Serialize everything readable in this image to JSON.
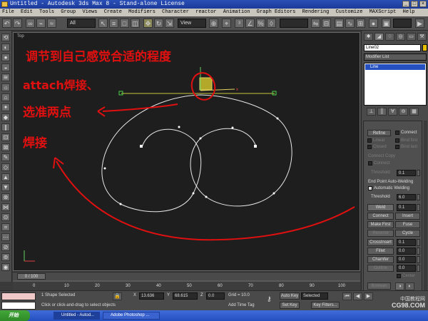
{
  "window": {
    "title": "Untitled - Autodesk 3ds Max 8  - Stand-alone License"
  },
  "menu": [
    "File",
    "Edit",
    "Tools",
    "Group",
    "Views",
    "Create",
    "Modifiers",
    "Character",
    "reactor",
    "Animation",
    "Graph Editors",
    "Rendering",
    "Customize",
    "MAXScript",
    "Help"
  ],
  "toolbar": {
    "selection_filter": "All",
    "reference_coord": "View"
  },
  "viewport": {
    "label": "Top",
    "annotations": {
      "line1": "调节到自己感觉合适的程度",
      "line2": "attach焊接、",
      "line3": "选准两点",
      "line4": "焊接"
    },
    "colors": {
      "background": "#1e1e1e",
      "spline": "#e8e8e8",
      "annotation": "#e01010",
      "handle": "#c8c83c"
    }
  },
  "command_panel": {
    "object_name": "Line02",
    "object_color": "#e8c000",
    "modifier_list": "Modifier List",
    "stack_item": "Line",
    "geometry": {
      "refine_label": "Refine",
      "connect_label": "Connect",
      "linear_label": "Linear",
      "bind_first_label": "Bind first",
      "closed_label": "Closed",
      "bind_last_label": "Bind last",
      "connect_copy_label": "Connect Copy",
      "connect_sub_label": "Connect",
      "threshold_label": "Threshold",
      "threshold_value": "0.1",
      "end_point_auto_weld": "End Point Auto-Welding",
      "automatic_welding": "Automatic Welding",
      "threshold2_label": "Threshold",
      "threshold2_value": "6.0",
      "weld_label": "Weld",
      "weld_value": "0.1",
      "connect_btn": "Connect",
      "insert_btn": "Insert",
      "make_first_btn": "Make First",
      "fuse_btn": "Fuse",
      "reverse_btn": "Reverse",
      "cycle_btn": "Cycle",
      "crossinsert_label": "CrossInsert",
      "crossinsert_value": "0.1",
      "fillet_label": "Fillet",
      "fillet_value": "0.0",
      "chamfer_label": "Chamfer",
      "chamfer_value": "0.0",
      "outline_label": "Outline",
      "outline_value": "0.0",
      "center_label": "Center",
      "boolean_label": "Boolean"
    }
  },
  "time_slider": {
    "frame_text": "0 / 100",
    "ticks": [
      "0",
      "10",
      "20",
      "30",
      "40",
      "50",
      "60",
      "70",
      "80",
      "90",
      "100"
    ]
  },
  "status": {
    "selection": "1 Shape Selected",
    "prompt": "Click or click-and-drag to select objects",
    "x_label": "X",
    "x_value": "13.636",
    "y_label": "Y",
    "y_value": "68.615",
    "z_label": "Z",
    "z_value": "0.0",
    "grid": "Grid = 10.0",
    "add_time_tag": "Add Time Tag",
    "auto_key": "Auto Key",
    "key_mode": "Selected",
    "set_key": "Set Key",
    "key_filters": "Key Filters..."
  },
  "taskbar": {
    "start_label": "开始",
    "tasks": [
      "Untitled - Autod...",
      "Adobe Photoshop ..."
    ]
  },
  "watermark": {
    "line1": "中国教程网",
    "line2": "CG98.COM"
  }
}
